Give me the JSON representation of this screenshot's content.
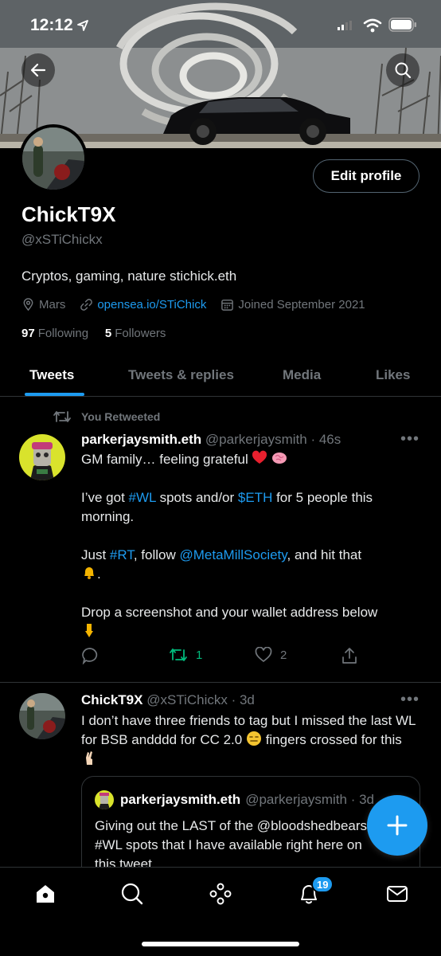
{
  "status": {
    "time": "12:12"
  },
  "profile": {
    "name": "ChickT9X",
    "handle": "@xSTiChickx",
    "edit_label": "Edit profile",
    "bio": "Cryptos, gaming, nature stichick.eth",
    "location": "Mars",
    "website": "opensea.io/STiChick",
    "joined": "Joined September 2021",
    "following_count": "97",
    "following_label": "Following",
    "followers_count": "5",
    "followers_label": "Followers"
  },
  "tabs": [
    {
      "label": "Tweets",
      "active": true
    },
    {
      "label": "Tweets & replies"
    },
    {
      "label": "Media"
    },
    {
      "label": "Likes"
    }
  ],
  "tweets": [
    {
      "retweet_label": "You Retweeted",
      "author": "parkerjaysmith.eth",
      "handle": "@parkerjaysmith",
      "time": "· 46s",
      "line1": "GM family… feeling grateful",
      "p2_a": "I’ve got ",
      "p2_tag": "#WL",
      "p2_b": " spots and/or ",
      "p2_cash": "$ETH",
      "p2_c": " for 5 people this morning.",
      "p3_a": "Just ",
      "p3_tag": "#RT",
      "p3_b": ", follow ",
      "p3_mention": "@MetaMillSociety",
      "p3_c": ", and hit that",
      "p3_d": ".",
      "p4": "Drop a screenshot and your wallet address below",
      "retweets": "1",
      "likes": "2"
    },
    {
      "author": "ChickT9X",
      "handle": "@xSTiChickx",
      "time": "· 3d",
      "text_a": "I don’t have three friends to tag but I missed the last WL for BSB andddd for CC 2.0",
      "text_b": "fingers crossed for this",
      "quote": {
        "author": "parkerjaysmith.eth",
        "handle": "@parkerjaysmith · 3d",
        "line1": "Giving out the LAST of the @bloodshedbears",
        "line2": "#WL spots that I have available right here on",
        "line3": "this tweet"
      }
    }
  ],
  "notifications_badge": "19",
  "colors": {
    "accent": "#1d9bf0",
    "retweet_green": "#00ba7c",
    "muted": "#71767b"
  }
}
